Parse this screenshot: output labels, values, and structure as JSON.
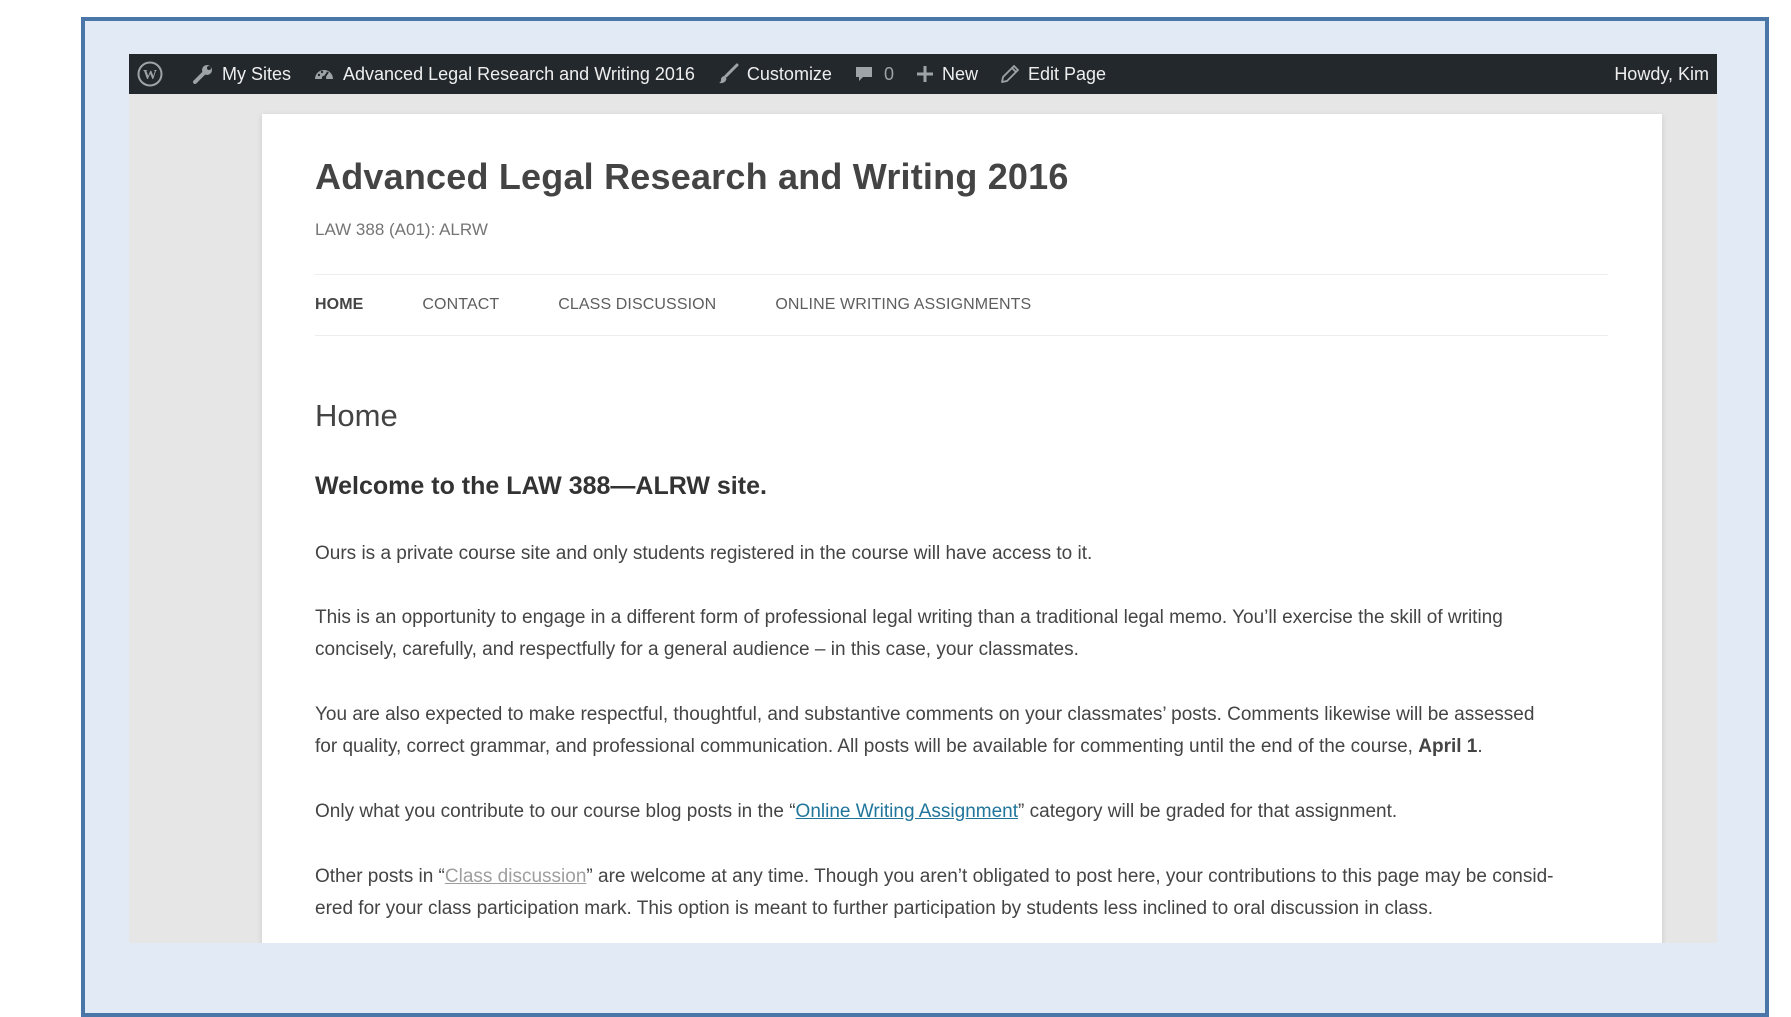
{
  "admin_bar": {
    "my_sites": "My Sites",
    "site_name": "Advanced Legal Research and Writing 2016",
    "customize": "Customize",
    "comments_count": "0",
    "new": "New",
    "edit_page": "Edit Page",
    "howdy": "Howdy, Kim"
  },
  "site": {
    "title": "Advanced Legal Research and Writing 2016",
    "description": "LAW 388 (A01): ALRW"
  },
  "nav": {
    "items": [
      "Home",
      "Contact",
      "Class Discussion",
      "Online Writing Assignments"
    ]
  },
  "page": {
    "title": "Home",
    "welcome": "Welcome to the LAW 388—ALRW site.",
    "p1": "Ours is a private course site and only students registered in the course will have access to it.",
    "p2_line1": "This is an opportunity to engage in a different form of professional legal writing than a traditional legal memo. You’ll exercise the skill of writing",
    "p2_line2": "concisely, carefully, and respectfully for a general audience – in this case, your classmates.",
    "p3_line1": "You are also expected to make respectful, thoughtful, and substantive comments on your classmates’ posts. Comments likewise will be assessed",
    "p3_line2": "for quality, correct grammar, and professional communication. All posts will be available for commenting until the end of the course,",
    "p3_bold": "April 1",
    "p3_end": ".",
    "p4_pre": "Only what you contribute to our course blog posts in the “",
    "p4_link": "Online Writing Assignment",
    "p4_post": "” category will be graded for that assignment.",
    "p5_pre": "Other posts in “",
    "p5_link": "Class discussion",
    "p5_post": "” are welcome at any time. Though you aren’t obligated to post here, your contributions to this page may be consid-",
    "p5_line2": "ered for your class participation mark. This option is meant to further participation by students less inclined to oral discussion in class."
  },
  "colors": {
    "frame_border": "#4a76a8",
    "frame_bg": "#e2ebf5",
    "admin_bar_bg": "#23282d",
    "link_blue": "#21759b"
  },
  "icons": [
    "wordpress-logo-icon",
    "wrench-icon",
    "dashboard-icon",
    "brush-icon",
    "comment-bubble-icon",
    "plus-icon",
    "pencil-icon"
  ]
}
